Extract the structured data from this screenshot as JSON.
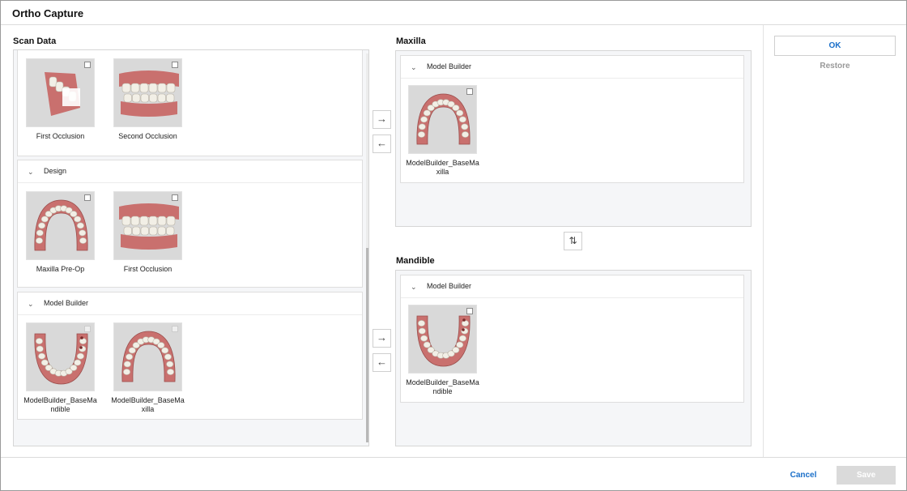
{
  "window": {
    "title": "Ortho Capture"
  },
  "scan_data": {
    "label": "Scan Data",
    "top_group": {
      "items": [
        {
          "caption": "First Occlusion",
          "kind": "occlusion-side"
        },
        {
          "caption": "Second Occlusion",
          "kind": "occlusion-front"
        }
      ]
    },
    "design_group": {
      "title": "Design",
      "items": [
        {
          "caption": "Maxilla Pre-Op",
          "kind": "arch-upper"
        },
        {
          "caption": "First Occlusion",
          "kind": "occlusion-front"
        }
      ]
    },
    "model_builder_group": {
      "title": "Model Builder",
      "items": [
        {
          "caption": "ModelBuilder_BaseMandible",
          "kind": "arch-lower"
        },
        {
          "caption": "ModelBuilder_BaseMaxilla",
          "kind": "arch-upper"
        }
      ]
    }
  },
  "maxilla": {
    "label": "Maxilla",
    "group_title": "Model Builder",
    "item": {
      "caption": "ModelBuilder_BaseMaxilla",
      "kind": "arch-upper"
    }
  },
  "mandible": {
    "label": "Mandible",
    "group_title": "Model Builder",
    "item": {
      "caption": "ModelBuilder_BaseMandible",
      "kind": "arch-lower"
    }
  },
  "actions": {
    "ok": "OK",
    "restore": "Restore",
    "cancel": "Cancel",
    "save": "Save"
  },
  "icons": {
    "arrow_right": "→",
    "arrow_left": "←",
    "chevron": "⌄",
    "swap": "⇅"
  },
  "colors": {
    "accent": "#1a6fc9",
    "gum": "#c9706e",
    "tooth": "#f2efe6",
    "thumb_bg": "#d9d9d9"
  }
}
